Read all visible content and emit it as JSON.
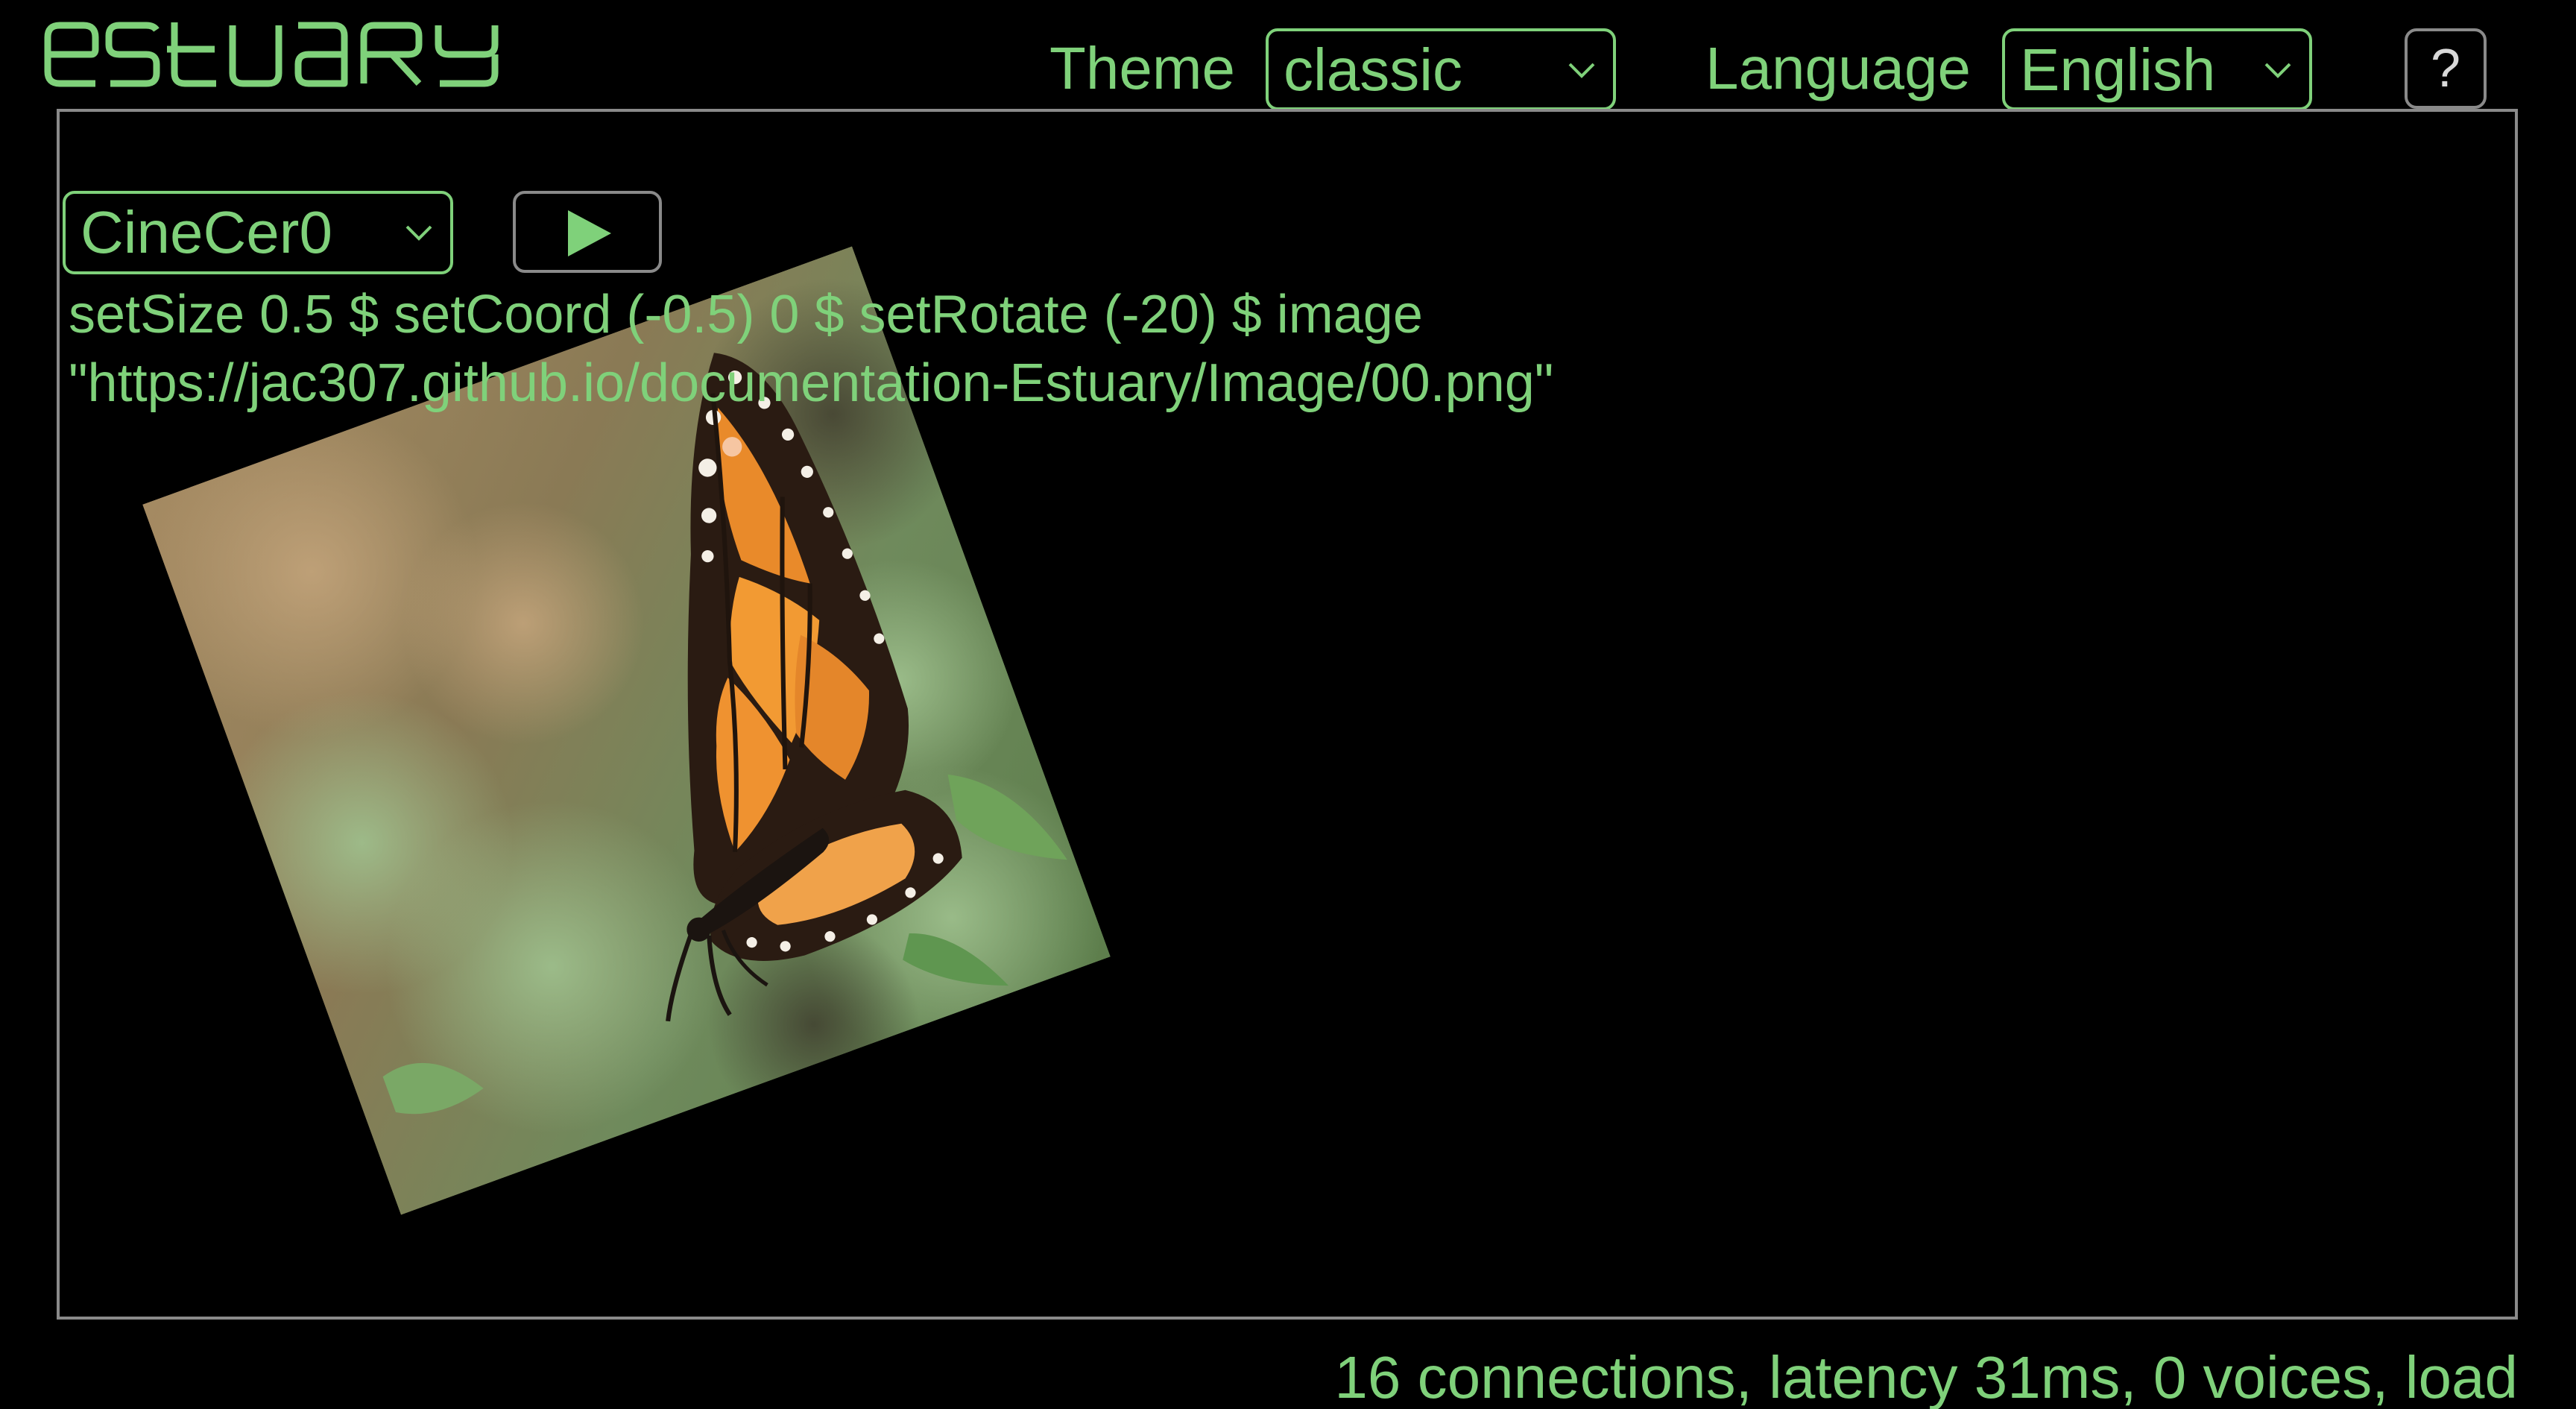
{
  "app": {
    "name": "estuary",
    "accent_color": "#7fd17a",
    "border_color": "#8a8a8a",
    "background": "#000000"
  },
  "header": {
    "theme_label": "Theme",
    "theme_value": "classic",
    "language_label": "Language",
    "language_value": "English",
    "help_label": "?"
  },
  "editor": {
    "renderer_value": "CineCer0",
    "play_icon": "play-icon",
    "code": "setSize 0.5 $ setCoord (-0.5) 0 $ setRotate (-20) $ image\n\"https://jac307.github.io/documentation-Estuary/Image/00.png\""
  },
  "canvas": {
    "image_subject": "monarch-butterfly-image",
    "rotation_deg": -20
  },
  "status": {
    "text": "16 connections, latency 31ms, 0 voices, load"
  }
}
